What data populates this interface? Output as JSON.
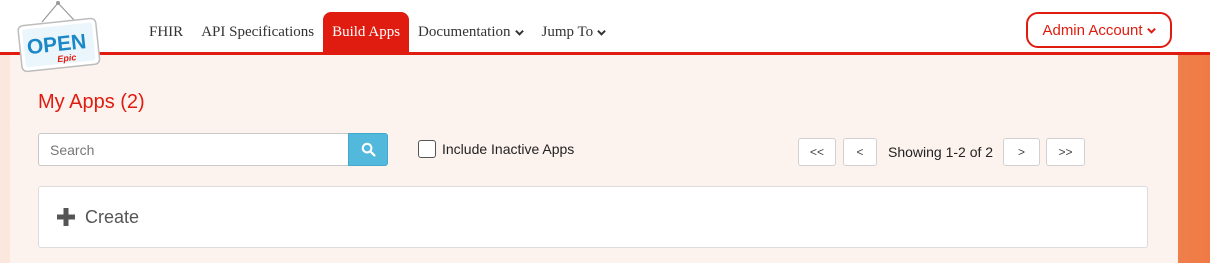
{
  "logo": {
    "word_top": "OPEN",
    "word_bottom": "Epic"
  },
  "nav": {
    "items": [
      {
        "label": "FHIR"
      },
      {
        "label": "API Specifications"
      },
      {
        "label": "Build Apps"
      },
      {
        "label": "Documentation"
      },
      {
        "label": "Jump To"
      }
    ],
    "active_index": 2
  },
  "account": {
    "label": "Admin Account"
  },
  "main": {
    "title": "My Apps (2)",
    "search": {
      "placeholder": "Search",
      "value": ""
    },
    "include_inactive": {
      "label": "Include Inactive Apps",
      "checked": false
    },
    "pagination": {
      "first": "<<",
      "prev": "<",
      "status": "Showing 1-2 of 2",
      "next": ">",
      "last": ">>"
    },
    "create": {
      "label": "Create"
    }
  },
  "colors": {
    "brand_red": "#e01b0f",
    "search_blue": "#52b8dc"
  },
  "icons": [
    "search-icon",
    "chevron-down-icon",
    "plus-icon"
  ]
}
